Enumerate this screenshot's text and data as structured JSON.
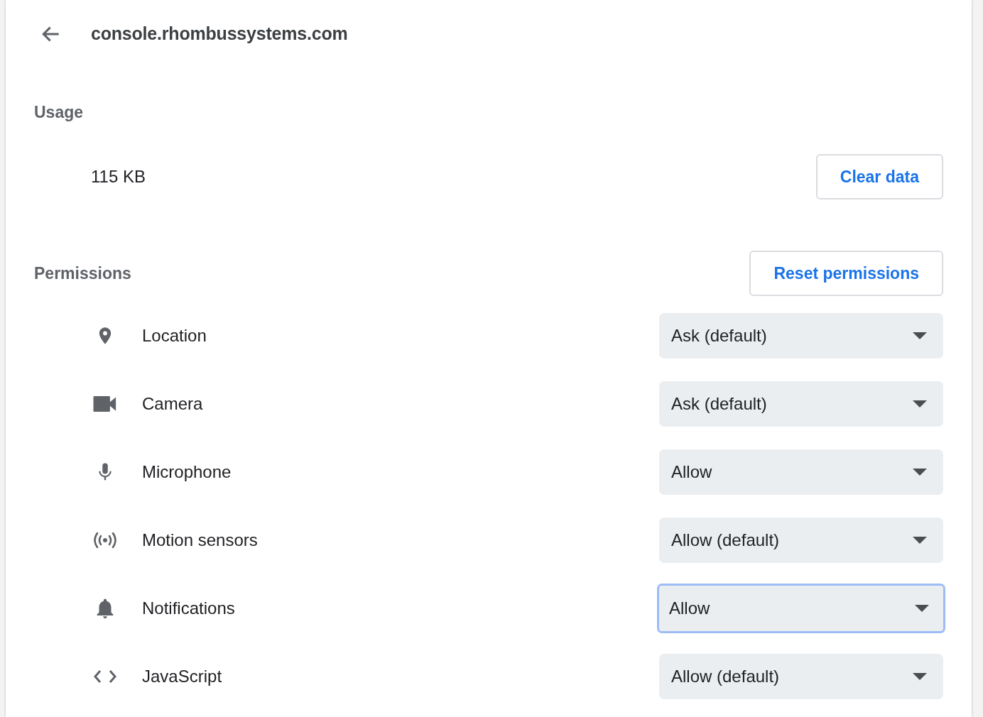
{
  "header": {
    "title": "console.rhombussystems.com"
  },
  "usage": {
    "heading": "Usage",
    "amount": "115 KB",
    "button": "Clear data"
  },
  "permissions_section": {
    "heading": "Permissions",
    "button": "Reset permissions"
  },
  "permissions": [
    {
      "label": "Location",
      "value": "Ask (default)",
      "focused": false
    },
    {
      "label": "Camera",
      "value": "Ask (default)",
      "focused": false
    },
    {
      "label": "Microphone",
      "value": "Allow",
      "focused": false
    },
    {
      "label": "Motion sensors",
      "value": "Allow (default)",
      "focused": false
    },
    {
      "label": "Notifications",
      "value": "Allow",
      "focused": true
    },
    {
      "label": "JavaScript",
      "value": "Allow (default)",
      "focused": false
    }
  ]
}
